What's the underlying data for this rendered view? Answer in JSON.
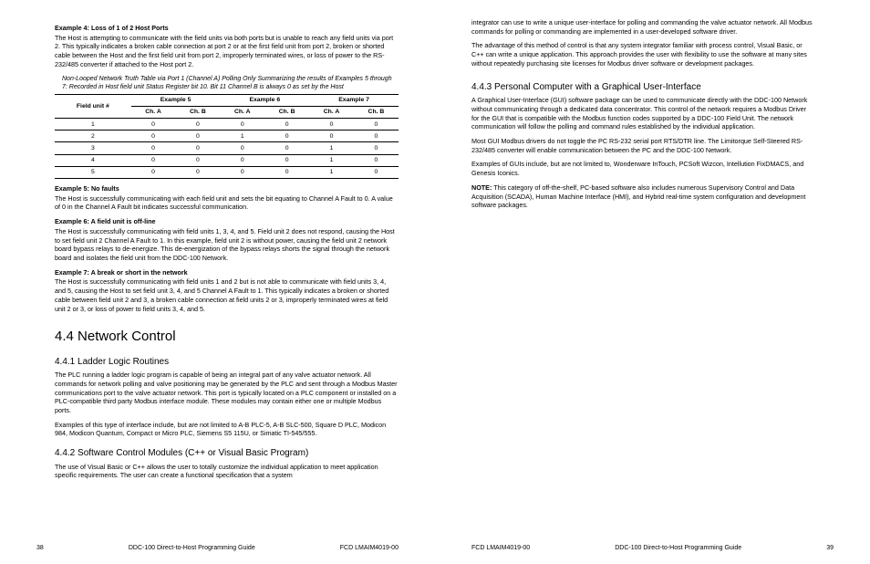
{
  "left": {
    "ex4_title": "Example 4: Loss of 1 of 2 Host Ports",
    "ex4_body": "The Host is attempting to communicate with the field units via both ports but is unable to reach any field units via port 2. This typically indicates a broken cable connection at port 2 or at the first field unit from port 2, broken or shorted cable between the Host and the first field unit from port 2, improperly terminated wires, or loss of power to the RS-232/485 converter if attached to the Host port 2.",
    "table_caption": "Non-Looped Network Truth Table via Port 1 (Channel A) Polling Only Summarizing the results of Examples 5 through 7: Recorded in Host field unit Status Register bit 10. Bit 11 Channel B is always 0 as set by the Host",
    "table": {
      "headers_top": [
        "Field unit #",
        "Example 5",
        "Example 6",
        "Example 7"
      ],
      "headers_sub": [
        "Ch. A",
        "Ch. B",
        "Ch. A",
        "Ch. B",
        "Ch. A",
        "Ch. B"
      ],
      "rows": [
        [
          "1",
          "0",
          "0",
          "0",
          "0",
          "0",
          "0"
        ],
        [
          "2",
          "0",
          "0",
          "1",
          "0",
          "0",
          "0"
        ],
        [
          "3",
          "0",
          "0",
          "0",
          "0",
          "1",
          "0"
        ],
        [
          "4",
          "0",
          "0",
          "0",
          "0",
          "1",
          "0"
        ],
        [
          "5",
          "0",
          "0",
          "0",
          "0",
          "1",
          "0"
        ]
      ]
    },
    "ex5_title": "Example 5: No faults",
    "ex5_body": "The Host is successfully communicating with each field unit and sets the bit equating to Channel A Fault to 0. A value of 0 in the Channel A Fault bit indicates successful communication.",
    "ex6_title": "Example 6: A field unit is off-line",
    "ex6_body": "The Host is successfully communicating with field units 1, 3, 4, and 5. Field unit 2 does not respond, causing the Host to set field unit 2 Channel A Fault to 1. In this example, field unit 2 is without power, causing the field unit 2 network board bypass relays to de-energize. This de-energization of the bypass relays shorts the signal through the network board and isolates the field unit from the DDC-100 Network.",
    "ex7_title": "Example 7: A break or short in the network",
    "ex7_body": "The Host is successfully communicating with field units 1 and 2 but is not able to communicate with field units 3, 4, and 5, causing the Host to set field unit 3, 4, and 5 Channel A Fault to 1. This typically indicates a broken or shorted cable between field unit 2 and 3, a broken cable connection at field units 2 or 3, improperly terminated wires at field unit 2 or 3, or loss of power to field units 3, 4, and 5.",
    "h2": "4.4  Network Control",
    "h3_441": "4.4.1  Ladder Logic Routines",
    "p441a": "The PLC running a ladder logic program is capable of being an integral part of any valve actuator network. All commands for network polling and valve positioning may be generated by the PLC and sent through a Modbus Master communications port to the valve actuator network. This port is typically located on a PLC component or installed on a PLC-compatible third party Modbus interface module. These modules may contain either one or multiple Modbus ports.",
    "p441b": "Examples of this type of interface include, but are not limited to A-B PLC-5, A-B SLC-500, Square D PLC, Modicon 984, Modicon Quantum, Compact or Micro PLC, Siemens S5 115U, or Simatic TI-545/555.",
    "h3_442": "4.4.2  Software Control Modules (C++ or Visual Basic Program)",
    "p442": "The use of Visual Basic or C++ allows the user to totally customize the individual application to meet application specific requirements. The user can create a functional specification that a system",
    "footer_page": "38",
    "footer_center": "DDC-100 Direct-to-Host Programming Guide",
    "footer_right": "FCD LMAIM4019-00"
  },
  "right": {
    "p_top1": "integrator can use to write a unique user-interface for polling and commanding the valve actuator network. All Modbus commands for polling or commanding are implemented in a user-developed software driver.",
    "p_top2": "The advantage of this method of control is that any system integrator familiar with process control, Visual Basic, or C++ can write a unique application. This approach provides the user with flexibility to use the software at many sites without repeatedly purchasing site licenses for Modbus driver software or development packages.",
    "h3_443": "4.4.3  Personal Computer with a Graphical User-Interface",
    "p443a": "A Graphical User-Interface (GUI) software package can be used to communicate directly with the DDC-100 Network without communicating through a dedicated data concentrator. This control of the network requires a Modbus Driver for the GUI that is compatible with the Modbus function codes supported by a DDC-100 Field Unit. The network communication will follow the polling and command rules established by the individual application.",
    "p443b": "Most GUI Modbus drivers do not toggle the PC RS-232 serial port RTS/DTR line. The Limitorque Self-Steered RS-232/485 converter will enable communication between the PC and the DDC-100 Network.",
    "p443c": "Examples of GUIs include, but are not limited to, Wonderware InTouch, PCSoft Wizcon, Intellution FixDMACS, and Genesis Iconics.",
    "note_label": "NOTE:",
    "note_body": " This category of off-the-shelf, PC-based software also includes numerous Supervisory Control and Data Acquisition (SCADA), Human Machine Interface (HMI), and Hybrid real-time system configuration and development software packages.",
    "footer_left": "FCD LMAIM4019-00",
    "footer_center": "DDC-100 Direct-to-Host Programming Guide",
    "footer_page": "39"
  }
}
